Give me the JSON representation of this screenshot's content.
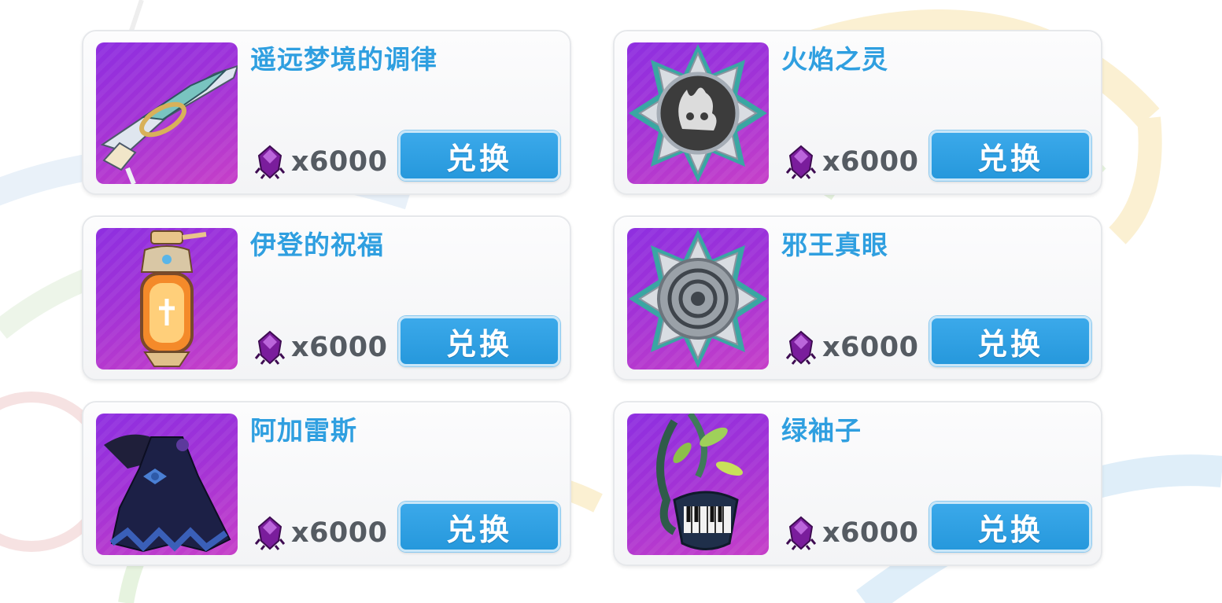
{
  "theme": {
    "accent_blue": "#2f9fe0",
    "button_blue": "#2698dc",
    "thumb_purple": "#9b30dc",
    "price_gray": "#555b62"
  },
  "currency": {
    "icon": "purple-crystal-icon"
  },
  "items": [
    {
      "name": "遥远梦境的调律",
      "price": "x6000",
      "button": "兑换",
      "icon": "sword-icon"
    },
    {
      "name": "火焰之灵",
      "price": "x6000",
      "button": "兑换",
      "icon": "fire-spirit-badge-icon"
    },
    {
      "name": "伊登的祝福",
      "price": "x6000",
      "button": "兑换",
      "icon": "lantern-icon"
    },
    {
      "name": "邪王真眼",
      "price": "x6000",
      "button": "兑换",
      "icon": "eye-badge-icon"
    },
    {
      "name": "阿加雷斯",
      "price": "x6000",
      "button": "兑换",
      "icon": "gothic-dress-icon"
    },
    {
      "name": "绿袖子",
      "price": "x6000",
      "button": "兑换",
      "icon": "piano-vine-icon"
    }
  ]
}
